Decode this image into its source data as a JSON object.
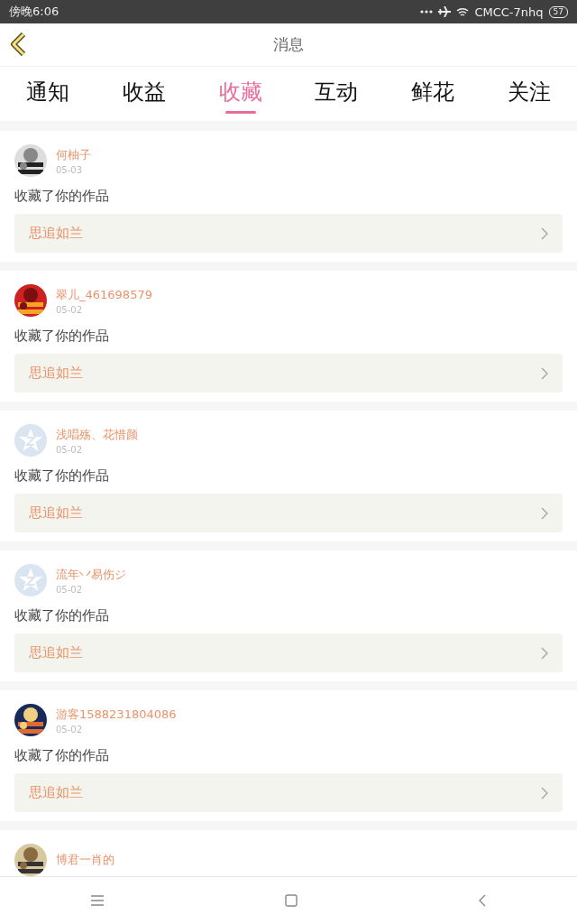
{
  "status_bar": {
    "time": "傍晚6:06",
    "carrier": "CMCC-7nhq",
    "battery": "57"
  },
  "header": {
    "title": "消息"
  },
  "tabs": [
    {
      "label": "通知",
      "selected": false
    },
    {
      "label": "收益",
      "selected": false
    },
    {
      "label": "收藏",
      "selected": true
    },
    {
      "label": "互动",
      "selected": false
    },
    {
      "label": "鲜花",
      "selected": false
    },
    {
      "label": "关注",
      "selected": false
    }
  ],
  "messages": [
    {
      "name": "何柚子",
      "date": "05-03",
      "text": "收藏了你的作品",
      "work": "思追如兰"
    },
    {
      "name": "翠儿_461698579",
      "date": "05-02",
      "text": "收藏了你的作品",
      "work": "思追如兰"
    },
    {
      "avatar": {
        "kind": "default"
      },
      "name": "浅唱殇、花惜颜",
      "date": "05-02",
      "text": "收藏了你的作品",
      "work": "思追如兰"
    },
    {
      "avatar": {
        "kind": "default"
      },
      "name": "流年丷易伤ジ",
      "date": "05-02",
      "text": "收藏了你的作品",
      "work": "思追如兰"
    },
    {
      "name": "游客1588231804086",
      "date": "05-02",
      "text": "收藏了你的作品",
      "work": "思追如兰"
    },
    {
      "name": "博君一肖的"
    }
  ]
}
